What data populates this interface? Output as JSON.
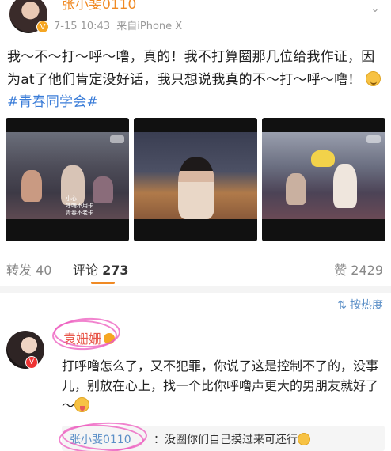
{
  "post": {
    "author": "张小斐0110",
    "time": "7-15 10:43",
    "source": "来自iPhone X",
    "text_before_topic": "我～不～打～呼～噜，真的！我不打算圈那几位给我作证，因为at了他们肯定没好话，我只想说我真的不～打～呼～噜！",
    "emoji": "upside-down-face-icon",
    "topic": "#青春同学会#",
    "images": [
      {
        "caption": "小心\n呼噜不用卡\n青春不老卡"
      },
      {
        "caption": ""
      },
      {
        "caption": ""
      }
    ]
  },
  "actions": {
    "repost_label": "转发",
    "repost_count": "40",
    "comment_label": "评论",
    "comment_count": "273",
    "like_label": "赞",
    "like_count": "2429"
  },
  "sort": {
    "label": "按热度",
    "icon": "sort-icon"
  },
  "comment": {
    "author": "袁姗姗",
    "text": "打呼噜怎么了，又不犯罪，你说了这是控制不了的，没事儿，别放在心上，找一个比你呼噜声更大的男朋友就好了～",
    "emoji": "tongue-out-face-icon",
    "reply": {
      "author": "张小斐0110",
      "text": "：没圈你们自己摸过来可还行"
    }
  },
  "colors": {
    "accent": "#f08a24",
    "link": "#3b7dd8",
    "muted": "#999999",
    "annotation": "#ec5abe"
  }
}
